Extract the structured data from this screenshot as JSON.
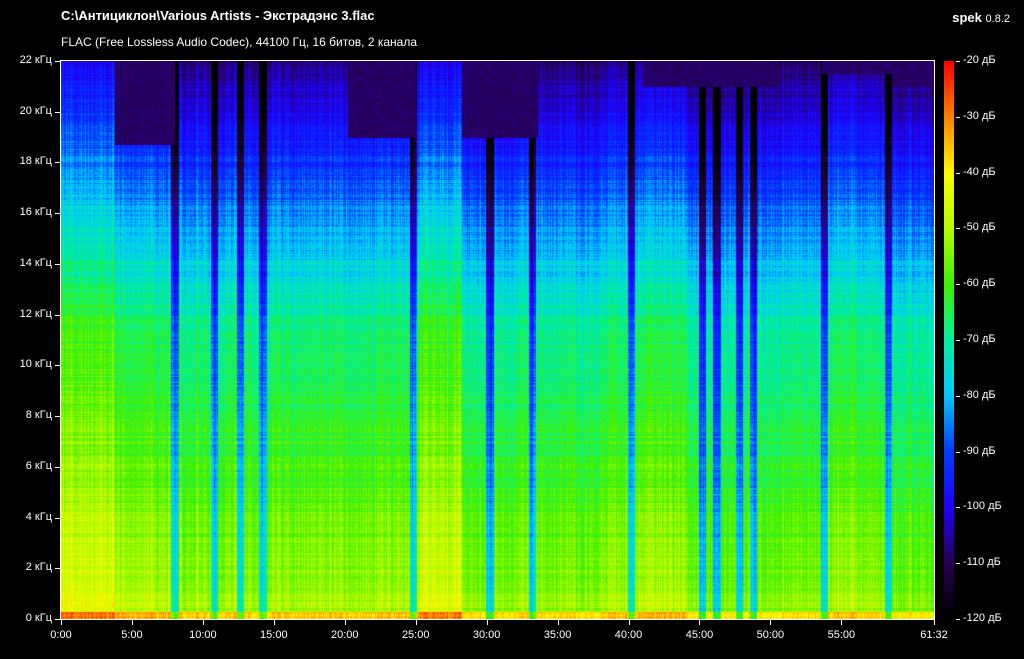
{
  "header": {
    "file_path": "C:\\Антициклон\\Various Artists - Экстрадэнс 3.flac",
    "file_info": "FLAC (Free Lossless Audio Codec), 44100 Гц, 16 битов, 2 канала",
    "app_name": "spek",
    "app_version": "0.8.2"
  },
  "chart_data": {
    "type": "heatmap",
    "title": "Spectrogram",
    "x_unit": "time (min)",
    "xlim": [
      0,
      61.53
    ],
    "ylim_khz": [
      0,
      22
    ],
    "zlim_db": [
      -120,
      -20
    ],
    "y_tick_labels": [
      "0 кГц",
      "2 кГц",
      "4 кГц",
      "6 кГц",
      "8 кГц",
      "10 кГц",
      "12 кГц",
      "14 кГц",
      "16 кГц",
      "18 кГц",
      "20 кГц",
      "22 кГц"
    ],
    "x_tick_labels": [
      "0:00",
      "5:00",
      "10:00",
      "15:00",
      "20:00",
      "25:00",
      "30:00",
      "35:00",
      "40:00",
      "45:00",
      "50:00",
      "55:00",
      "61:32"
    ],
    "x_tick_values": [
      0,
      5,
      10,
      15,
      20,
      25,
      30,
      35,
      40,
      45,
      50,
      55,
      61.53
    ],
    "db_tick_labels": [
      "-20 дБ",
      "-30 дБ",
      "-40 дБ",
      "-50 дБ",
      "-60 дБ",
      "-70 дБ",
      "-80 дБ",
      "-90 дБ",
      "-100 дБ",
      "-110 дБ",
      "-120 дБ"
    ],
    "segments": [
      {
        "start": 0,
        "end": 3.8,
        "cutoff_khz": 22,
        "level_db": -52
      },
      {
        "start": 3.8,
        "end": 8.0,
        "cutoff_khz": 18.7,
        "level_db": -58
      },
      {
        "start": 8.0,
        "end": 20.2,
        "cutoff_khz": 22,
        "level_db": -60
      },
      {
        "start": 20.2,
        "end": 25.0,
        "cutoff_khz": 19,
        "level_db": -60
      },
      {
        "start": 25.0,
        "end": 28.2,
        "cutoff_khz": 22,
        "level_db": -54
      },
      {
        "start": 28.2,
        "end": 33.6,
        "cutoff_khz": 19,
        "level_db": -62
      },
      {
        "start": 33.6,
        "end": 38.0,
        "cutoff_khz": 22,
        "level_db": -62
      },
      {
        "start": 38.0,
        "end": 41.0,
        "cutoff_khz": 22,
        "level_db": -60
      },
      {
        "start": 41.0,
        "end": 44.0,
        "cutoff_khz": 21,
        "level_db": -58
      },
      {
        "start": 44.0,
        "end": 50.5,
        "cutoff_khz": 21,
        "level_db": -64
      },
      {
        "start": 50.5,
        "end": 53.6,
        "cutoff_khz": 22,
        "level_db": -62
      },
      {
        "start": 53.6,
        "end": 58.5,
        "cutoff_khz": 21.5,
        "level_db": -60
      },
      {
        "start": 58.5,
        "end": 61.53,
        "cutoff_khz": 21,
        "level_db": -64
      }
    ],
    "dark_stripes_min": [
      8.0,
      10.8,
      12.6,
      14.2,
      24.8,
      30.2,
      33.2,
      40.2,
      45.2,
      46.2,
      47.8,
      48.8,
      53.8,
      58.3
    ]
  }
}
